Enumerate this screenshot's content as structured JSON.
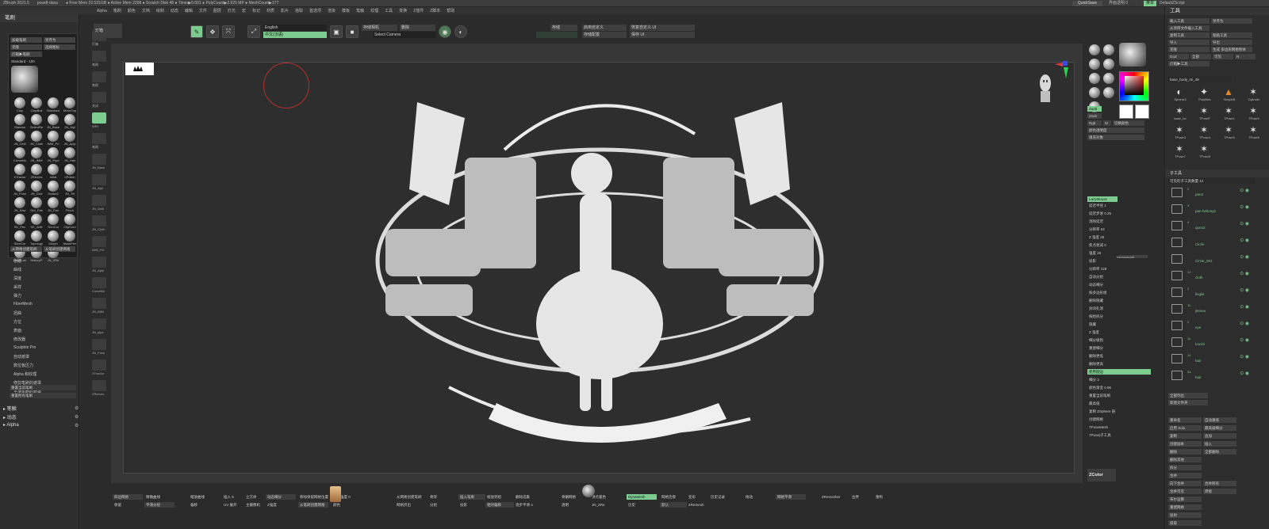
{
  "titlebar": {
    "text": [
      "ZBrush 2021.5",
      "pose8-dasa",
      "● Free Mem 22.531GB ● Active Mem 2208 ● Scratch Disk 48 ● Timer▶0.001 ● PolyCount▶2.625 MP ● MeshCount▶177"
    ]
  },
  "menubar": {
    "items": [
      "Alpha",
      "笔刷",
      "颜色",
      "文档",
      "绘制",
      "动态",
      "编辑",
      "文件",
      "图层",
      "灯光",
      "宏",
      "标记",
      "材质",
      "影片",
      "拾取",
      "首选项",
      "渲染",
      "模板",
      "笔触",
      "纹理",
      "工具",
      "变换",
      "Z插件",
      "Z脚本",
      "帮助"
    ]
  },
  "topright": {
    "quicksave": "QuickSave",
    "transparent": "界面透明 0",
    "menu": "菜单",
    "zscript": "DefaultZScript"
  },
  "left_panel": {
    "title": "笔刷",
    "load_brush": "加载笔刷",
    "save_as": "另存为",
    "clone": "克隆",
    "select_icon": "选择图标",
    "lightbox": "灯箱▶笔刷",
    "standard_label": "Standard",
    "standard_value": "100",
    "brush_labels": [
      "Clay",
      "ClayBuil",
      "Standard",
      "MoveTop",
      "Standar",
      "SelectRe",
      "JN_Base",
      "JN_Alpl",
      "JN_Gelli",
      "JN_Cloth",
      "IMM_Pri",
      "JN_Apip",
      "CurveMo",
      "JN_IMM",
      "JN_Pipe",
      "JN_Hair",
      "XTractor",
      "ZRemes",
      "Inflat",
      "hPolish",
      "JN_Pose",
      "JN_Grid",
      "Snake2",
      "JN_Tilt",
      "JN_Sew",
      "Orb_Fab",
      "JN_Pan",
      "Pinch",
      "SK_Pen",
      "SK_AirB",
      "TrimCur",
      "ClipCurv",
      "SliceCur",
      "Topology",
      "Morph",
      "MaskPen",
      "MaskLas",
      "HistoryP",
      "JN_ZRe"
    ],
    "create_from_mesh": "从网格创建笔刷",
    "create_from_mesh2": "从笔刷创建网格",
    "menu_items": [
      "创建",
      "曲线",
      "深度",
      "采样",
      "弹力",
      "FiberMesh",
      "扭曲",
      "方位",
      "表面",
      "修改器",
      "Sculptris Pro",
      "自动遮罩",
      "数位板压力",
      "Alpha 和纹理",
      "修剪笔刷的遮罩",
      "平滑笔刷的遮罩"
    ],
    "reset_current": "重置当前笔刷",
    "reset_all": "重置所有笔刷",
    "sections": [
      "笔触",
      "动态",
      "Alpha"
    ]
  },
  "left_shelf": {
    "labels": [
      "灯箱",
      "笔刷",
      "笔刷",
      "关闭",
      "WRt",
      "笔刷",
      "JN_Base",
      "JN_Alpl",
      "JN_Gelli",
      "JN_Cloth",
      "IMM_Pri",
      "JN_Apip",
      "CurveMo",
      "JN_IMM",
      "JN_pipe",
      "JN_Pose",
      "XTractor",
      "ZRemes"
    ],
    "number": "27"
  },
  "top_shelf": {
    "lightbox": "灯箱",
    "lang_en": "English",
    "lang_cn": "中文(汉语)",
    "save_camera": "存储相机",
    "delete": "删除",
    "select_camera": "Select Camera",
    "store_cfg": "存储配置",
    "custom_ui": "启用自定义",
    "load_cfg": "存储",
    "store_ui": "存储配置",
    "reset_custom": "恢复自定义 UI",
    "save_ui": "保存 UI",
    "gizmo": "Gizmo"
  },
  "right_tray": {
    "labels": [
      "Inflat",
      "BSUrdu",
      "Clay",
      "JN_Polish",
      "JN_Cloth",
      "JN_Apip",
      "JN_Alpl",
      "JN_Gelli",
      "JN_Pose"
    ],
    "zadd": "Zadd",
    "zsub": "Zsub",
    "rgb": "Rgb",
    "m": "M",
    "rgb_intensity": "切换颜色",
    "white": "颜色透明度",
    "fill": "填充对象",
    "lazymouse": "LazyMouse",
    "dynamesh": "Dynamesh",
    "items": [
      "延迟半径 1",
      "延迟步进 0.25",
      "消除延迟",
      "分辨率 64",
      "Z 强度 25",
      "焦点衰减 0",
      "强度 25",
      "投影",
      "分辨率 128",
      "自动分组",
      "动态细分",
      "按多边形组",
      "删除隐藏",
      "封闭孔洞",
      "按组拆分",
      "隐藏",
      "Z 强度",
      "细分级别",
      "重建细分",
      "删除更低",
      "删除更高",
      "使用圆边",
      "细分 3",
      "颜色渐变 0.96",
      "重置当前笔刷",
      "最高值",
      "复制 ZSphere 链",
      "创建网格",
      "TPoseMesh",
      "TPose|子工具"
    ],
    "zcolor": "ZColor",
    "polypaint": "Polypaint"
  },
  "tool_panel": {
    "title": "工具",
    "rows": [
      [
        "载入工具",
        "另存为"
      ],
      [
        "从项目文件载入工具",
        ""
      ],
      [
        "复制工具",
        "粘贴工具"
      ],
      [
        "导入",
        "导出"
      ],
      [
        "克隆",
        "生成 多边形网格物体"
      ],
      [
        "GoZ",
        "全部",
        "可见",
        "R"
      ],
      [
        "灯箱▶工具",
        ""
      ]
    ],
    "tool_name": "base_body_mi_48",
    "tool_value": "48",
    "tool_thumbs": [
      "Sphere3",
      "PolyMes",
      "SimpleB",
      "Cylinder",
      "base_bo",
      "TPoseF",
      "TPose1",
      "TPose2",
      "TPose3",
      "TPose4",
      "TPose5",
      "TPose6",
      "TPose7",
      "TPose8"
    ],
    "subtool_title": "子工具",
    "visible_count": "可见的子工具数量 12",
    "subtools": [
      {
        "num": "2",
        "name": "pan2"
      },
      {
        "num": "3",
        "name": "pan-heitong1"
      },
      {
        "num": "4",
        "name": "quno2"
      },
      {
        "num": "",
        "name": "Circle"
      },
      {
        "num": "",
        "name": "Circle_001"
      },
      {
        "num": "12",
        "name": "cloth"
      },
      {
        "num": "2",
        "name": "linglie"
      },
      {
        "num": "11",
        "name": "jiemao"
      },
      {
        "num": "2",
        "name": "eye"
      },
      {
        "num": "11",
        "name": "toushi"
      },
      {
        "num": "14",
        "name": "hair"
      },
      {
        "num": "34",
        "name": "hair"
      }
    ],
    "list_all": "全部列出",
    "new_folder": "新建文件夹",
    "actions": [
      [
        "重命名",
        "自动重排"
      ],
      [
        "启用 Solo",
        "最高级细分"
      ],
      [
        "复制",
        "追加"
      ],
      [
        "创建副本",
        "插入"
      ],
      [
        "删除",
        "全部删除"
      ],
      [
        "删除其他",
        ""
      ],
      [
        "拆分",
        ""
      ],
      [
        "合并",
        ""
      ],
      [
        "向下合并",
        "合并所有"
      ],
      [
        "合并可见",
        "焊接"
      ],
      [
        "布尔运算",
        ""
      ],
      [
        "重建网格",
        ""
      ],
      [
        "投射",
        ""
      ],
      [
        "提取",
        ""
      ]
    ]
  },
  "bottom_shelf": {
    "items": [
      "四边网格",
      "精确曲线",
      "缩放曲线",
      "插入 8",
      "立方体",
      "动态细分",
      "移除保留网格位置",
      "重力强度 0",
      "从网格创建笔刷",
      "骨架",
      "插入笔刷",
      "缩放到组",
      "删除选集",
      "骨骼网格",
      "顶点着色",
      "DynaMesh",
      "网格连接",
      "变形",
      "历史记录",
      "拖动",
      "网格平滑",
      "ZRemesher",
      "边界",
      "重构",
      "保留",
      "平滑分组",
      "偏移",
      "UV 展开",
      "主摄像机",
      "Z强度",
      "从笔刷创建网格",
      "颜色",
      "网格挤出",
      "分组",
      "投影",
      "相对偏移",
      "逐步平滑 4",
      "透明",
      "JN_ZRe",
      "历史",
      "默认",
      "ZRemesh"
    ]
  }
}
